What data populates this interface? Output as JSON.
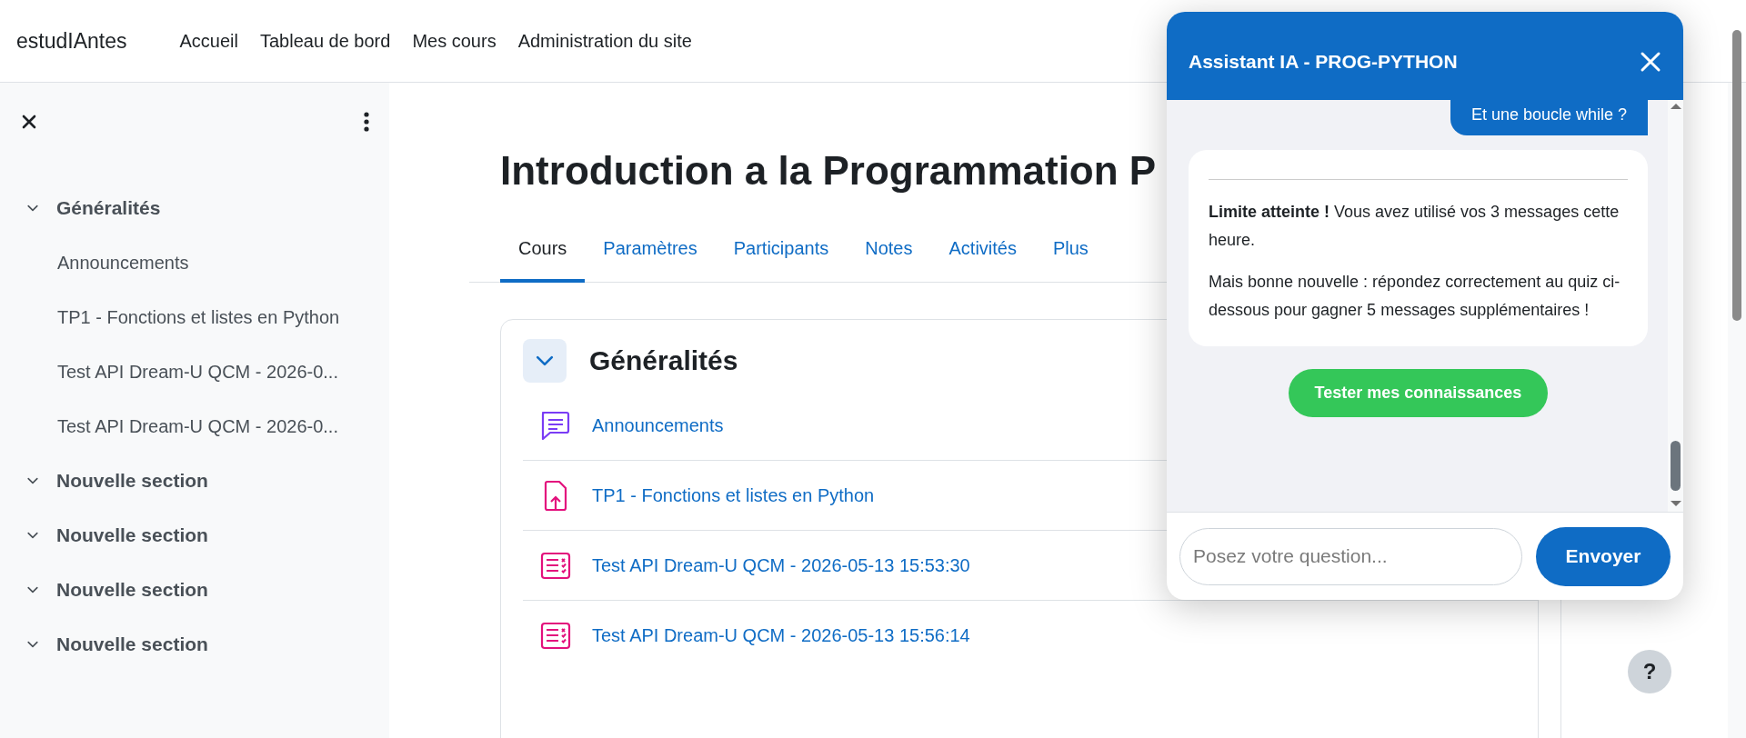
{
  "navbar": {
    "brand": "estudIAntes",
    "links": [
      {
        "label": "Accueil"
      },
      {
        "label": "Tableau de bord"
      },
      {
        "label": "Mes cours"
      },
      {
        "label": "Administration du site"
      }
    ]
  },
  "drawer": {
    "items": [
      {
        "label": "Généralités",
        "expanded": true,
        "children": [
          {
            "label": "Announcements"
          },
          {
            "label": "TP1 - Fonctions et listes en Python"
          },
          {
            "label": "Test API Dream-U QCM - 2026-0..."
          },
          {
            "label": "Test API Dream-U QCM - 2026-0..."
          }
        ]
      },
      {
        "label": "Nouvelle section",
        "expanded": true
      },
      {
        "label": "Nouvelle section",
        "expanded": true
      },
      {
        "label": "Nouvelle section",
        "expanded": true
      },
      {
        "label": "Nouvelle section",
        "expanded": true
      }
    ]
  },
  "course": {
    "title": "Introduction a la Programmation P",
    "tabs": [
      {
        "label": "Cours",
        "selected": true
      },
      {
        "label": "Paramètres",
        "selected": false
      },
      {
        "label": "Participants",
        "selected": false
      },
      {
        "label": "Notes",
        "selected": false
      },
      {
        "label": "Activités",
        "selected": false
      },
      {
        "label": "Plus",
        "selected": false
      }
    ],
    "section": {
      "title": "Généralités",
      "expanded": true,
      "activities": [
        {
          "kind": "forum",
          "label": "Announcements"
        },
        {
          "kind": "assign",
          "label": "TP1 - Fonctions et listes en Python"
        },
        {
          "kind": "quiz",
          "label": "Test API Dream-U QCM - 2026-05-13 15:53:30"
        },
        {
          "kind": "quiz",
          "label": "Test API Dream-U QCM - 2026-05-13 15:56:14"
        }
      ]
    }
  },
  "chat": {
    "title": "Assistant IA - PROG-PYTHON",
    "messages": [
      {
        "kind": "user",
        "text": "Et une boucle while ?"
      },
      {
        "kind": "bot",
        "paragraphs": [
          "**Limite atteinte !** Vous avez utilisé vos 3 messages cette heure.",
          "Mais bonne nouvelle : répondez correctement au quiz ci-dessous pour gagner 5 messages supplémentaires !"
        ]
      }
    ],
    "action_button": "Tester mes connaissances",
    "input": {
      "placeholder": "Posez votre question..."
    },
    "send_button": "Envoyer"
  },
  "help_button": "?"
}
